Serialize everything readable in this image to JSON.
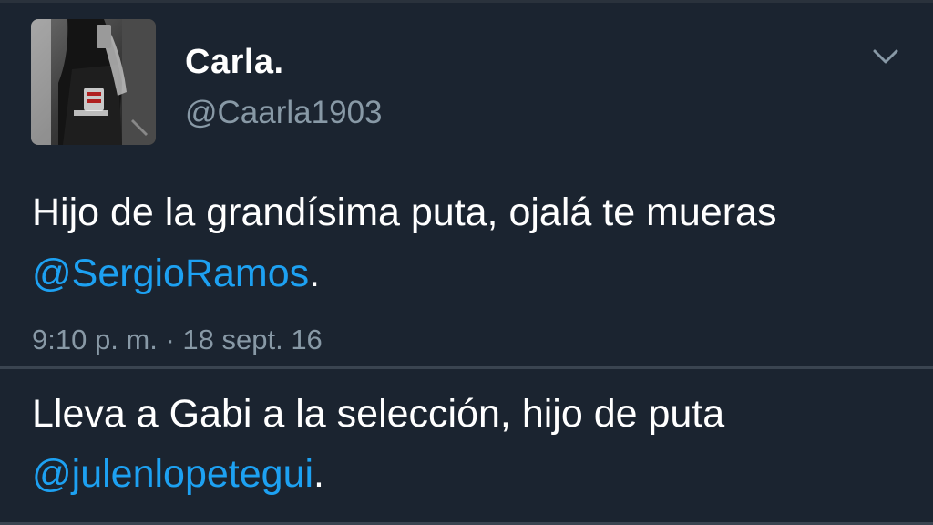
{
  "tweet": {
    "author_name": "Carla.",
    "author_handle": "@Caarla1903",
    "text_before": "Hijo de la grandísima puta, ojalá te mueras ",
    "mention": "@SergioRamos",
    "text_after": ".",
    "timestamp": "9:10 p. m. · 18 sept. 16",
    "menu_icon": "chevron-down-icon"
  },
  "reply": {
    "text_before": "Lleva a Gabi a la selección, hijo de puta ",
    "mention": "@julenlopetegui",
    "text_after": "."
  },
  "colors": {
    "background": "#1b2430",
    "text": "#ffffff",
    "muted": "#8899a6",
    "link": "#1da1f2",
    "divider": "#3a4450"
  }
}
